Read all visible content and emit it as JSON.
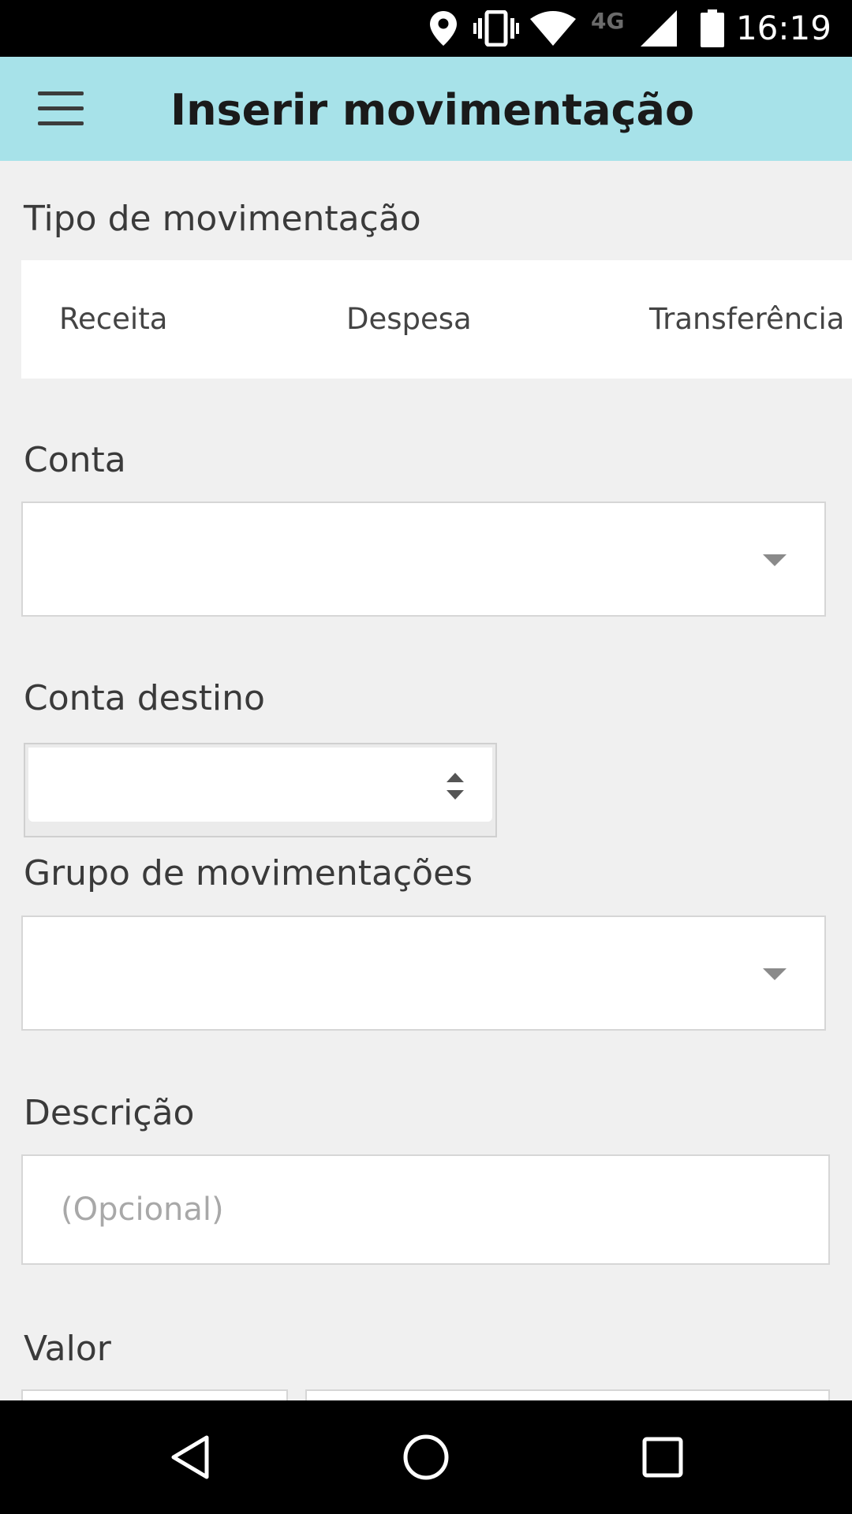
{
  "status_bar": {
    "time": "16:19",
    "network": "4G",
    "icons": [
      "location-icon",
      "vibrate-icon",
      "wifi-icon",
      "cell-signal-icon",
      "battery-icon"
    ]
  },
  "app_bar": {
    "title": "Inserir movimentação",
    "background": "#a7e2e9"
  },
  "form": {
    "type_label": "Tipo de movimentação",
    "type_options": [
      "Receita",
      "Despesa",
      "Transferência"
    ],
    "account_label": "Conta",
    "account_value": "",
    "dest_account_label": "Conta destino",
    "dest_account_value": "",
    "group_label": "Grupo de movimentações",
    "group_value": "",
    "description_label": "Descrição",
    "description_placeholder": "(Opcional)",
    "description_value": "",
    "value_label": "Valor"
  },
  "nav_bar": {
    "icons": [
      "back-icon",
      "home-icon",
      "recents-icon"
    ]
  }
}
